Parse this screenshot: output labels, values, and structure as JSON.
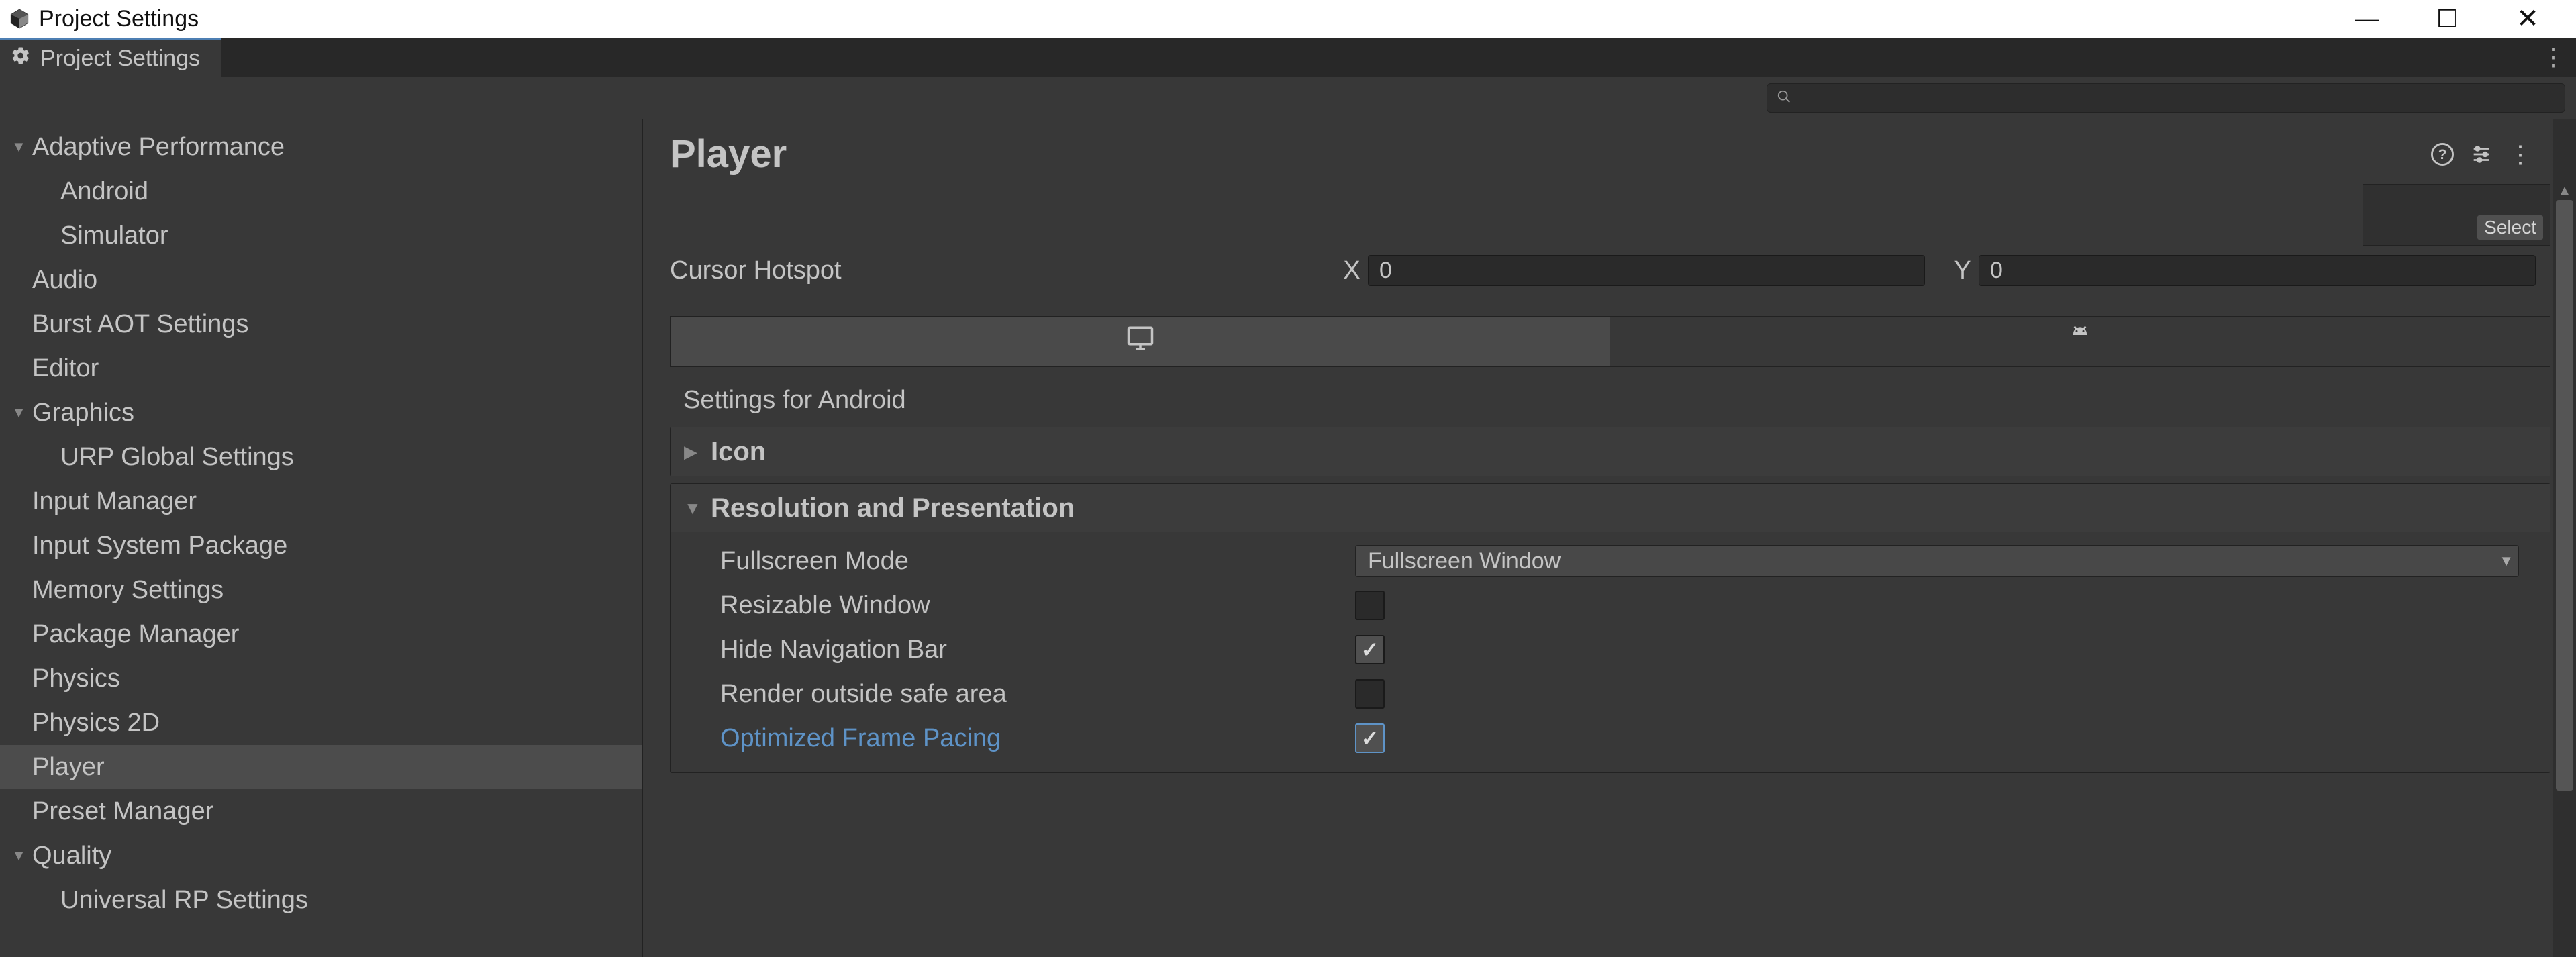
{
  "window": {
    "title": "Project Settings"
  },
  "tab": {
    "label": "Project Settings"
  },
  "search": {
    "placeholder": ""
  },
  "sidebar": {
    "items": [
      {
        "label": "Adaptive Performance",
        "expanded": true,
        "depth": 0
      },
      {
        "label": "Android",
        "depth": 1
      },
      {
        "label": "Simulator",
        "depth": 1
      },
      {
        "label": "Audio",
        "depth": 0
      },
      {
        "label": "Burst AOT Settings",
        "depth": 0
      },
      {
        "label": "Editor",
        "depth": 0
      },
      {
        "label": "Graphics",
        "expanded": true,
        "depth": 0
      },
      {
        "label": "URP Global Settings",
        "depth": 1
      },
      {
        "label": "Input Manager",
        "depth": 0
      },
      {
        "label": "Input System Package",
        "depth": 0
      },
      {
        "label": "Memory Settings",
        "depth": 0
      },
      {
        "label": "Package Manager",
        "depth": 0
      },
      {
        "label": "Physics",
        "depth": 0
      },
      {
        "label": "Physics 2D",
        "depth": 0
      },
      {
        "label": "Player",
        "depth": 0,
        "selected": true
      },
      {
        "label": "Preset Manager",
        "depth": 0
      },
      {
        "label": "Quality",
        "expanded": true,
        "depth": 0
      },
      {
        "label": "Universal RP Settings",
        "depth": 1
      }
    ]
  },
  "content": {
    "title": "Player",
    "select_btn": "Select",
    "cursor_hotspot": {
      "label": "Cursor Hotspot",
      "x_label": "X",
      "y_label": "Y",
      "x": "0",
      "y": "0"
    },
    "platform_subtitle": "Settings for Android",
    "foldouts": {
      "icon": {
        "title": "Icon",
        "expanded": false
      },
      "resolution": {
        "title": "Resolution and Presentation",
        "expanded": true,
        "fullscreen_mode": {
          "label": "Fullscreen Mode",
          "value": "Fullscreen Window"
        },
        "resizable_window": {
          "label": "Resizable Window",
          "checked": false
        },
        "hide_nav_bar": {
          "label": "Hide Navigation Bar",
          "checked": true
        },
        "render_outside_safe": {
          "label": "Render outside safe area",
          "checked": false
        },
        "optimized_frame_pacing": {
          "label": "Optimized Frame Pacing",
          "checked": true
        }
      }
    }
  }
}
